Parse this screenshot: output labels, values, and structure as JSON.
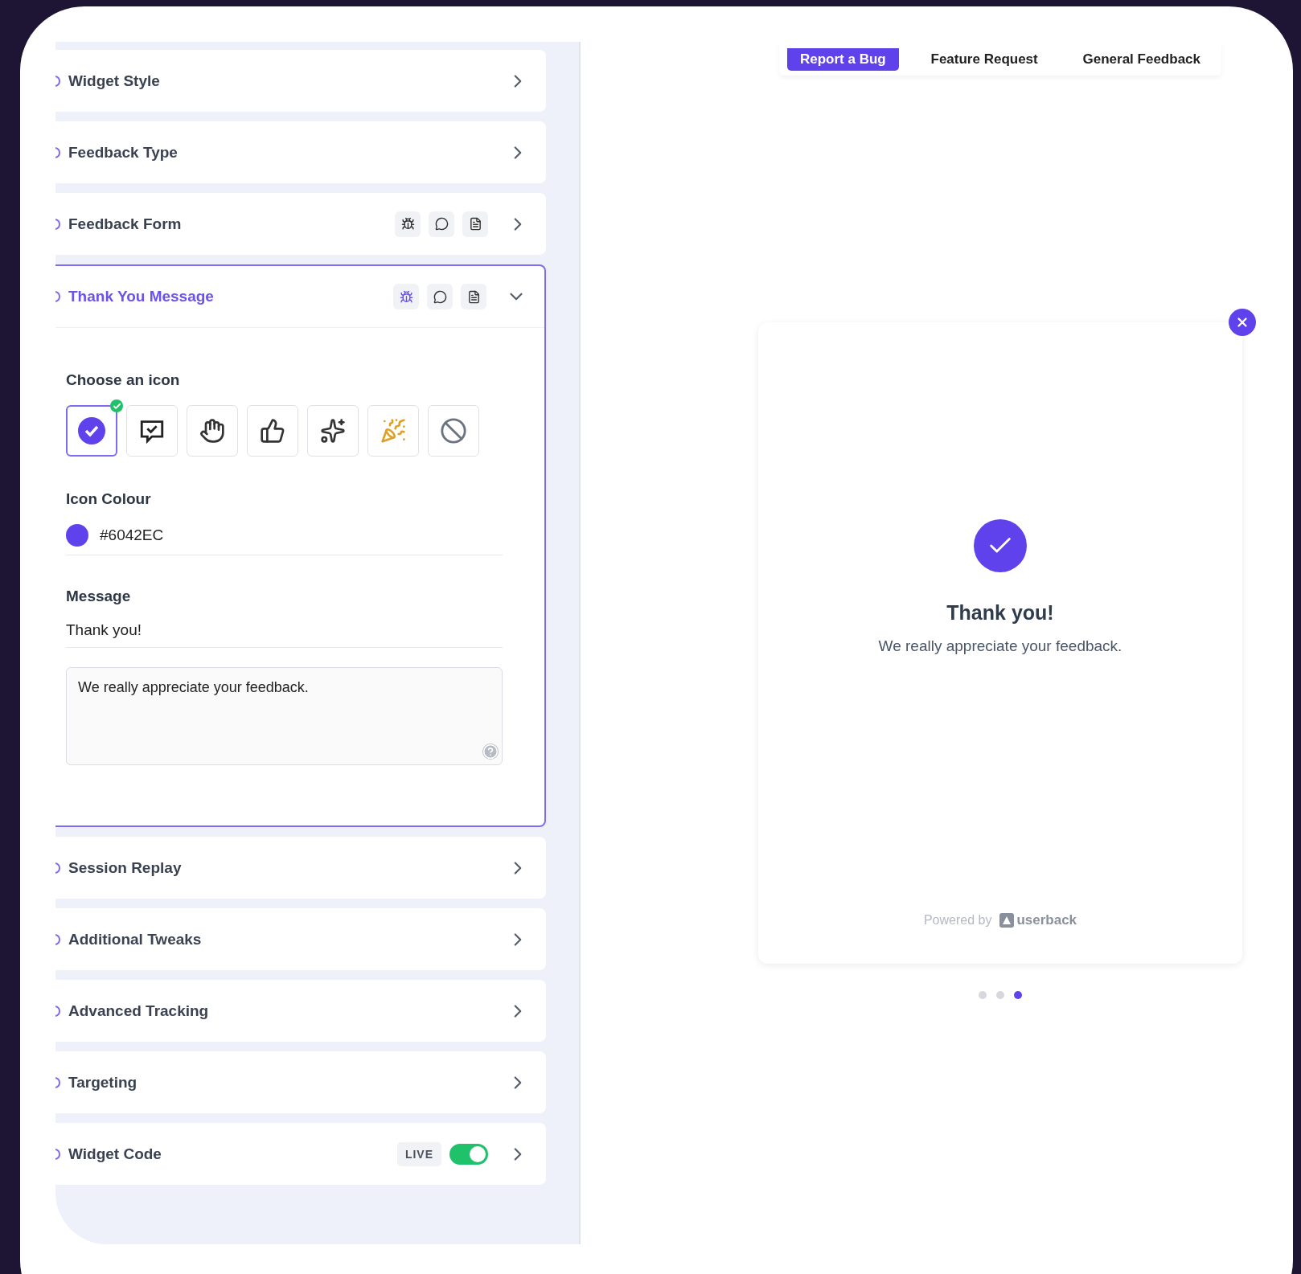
{
  "sections": [
    {
      "title": "Widget Style",
      "expanded": false
    },
    {
      "title": "Feedback Type",
      "expanded": false
    },
    {
      "title": "Feedback Form",
      "expanded": false,
      "type_icons": [
        {
          "kind": "bug",
          "selected": false
        },
        {
          "kind": "chat",
          "selected": false
        },
        {
          "kind": "document",
          "selected": false
        }
      ]
    },
    {
      "title": "Thank You Message",
      "expanded": true,
      "type_icons": [
        {
          "kind": "bug",
          "selected": true
        },
        {
          "kind": "chat",
          "selected": false
        },
        {
          "kind": "document",
          "selected": false
        }
      ]
    },
    {
      "title": "Session Replay",
      "expanded": false
    },
    {
      "title": "Additional Tweaks",
      "expanded": false
    },
    {
      "title": "Advanced Tracking",
      "expanded": false
    },
    {
      "title": "Targeting",
      "expanded": false
    },
    {
      "title": "Widget Code",
      "expanded": false,
      "badge": "LIVE",
      "toggle": {
        "on": true
      }
    }
  ],
  "thank_you_settings": {
    "icon_label": "Choose an icon",
    "icons": [
      {
        "kind": "check",
        "selected": true
      },
      {
        "kind": "chat-check",
        "selected": false
      },
      {
        "kind": "clap",
        "selected": false
      },
      {
        "kind": "thumbs-up",
        "selected": false
      },
      {
        "kind": "sparkle-star",
        "selected": false
      },
      {
        "kind": "party",
        "selected": false
      },
      {
        "kind": "none",
        "selected": false
      }
    ],
    "colour_label": "Icon Colour",
    "colour_value": "#6042EC",
    "color": "#6042ec",
    "message_label": "Message",
    "message_title": "Thank you!",
    "message_body": "We really appreciate your feedback."
  },
  "preview": {
    "tabs": [
      {
        "label": "Report a Bug",
        "selected": true
      },
      {
        "label": "Feature Request",
        "selected": false
      },
      {
        "label": "General Feedback",
        "selected": false
      }
    ],
    "title": "Thank you!",
    "message": "We really appreciate your feedback.",
    "powered_by": "Powered by",
    "brand": "userback",
    "dots": [
      {
        "selected": false
      },
      {
        "selected": false
      },
      {
        "selected": true
      }
    ]
  }
}
